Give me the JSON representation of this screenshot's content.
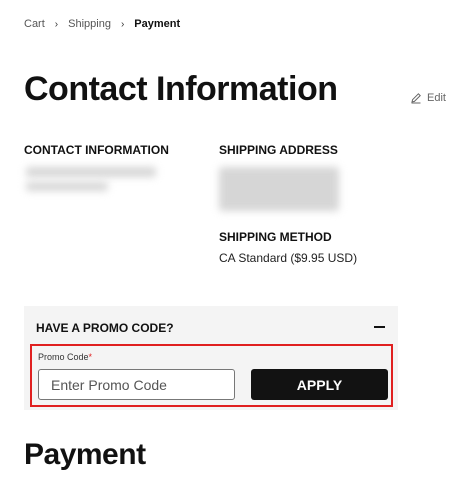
{
  "breadcrumb": {
    "items": [
      {
        "label": "Cart"
      },
      {
        "label": "Shipping"
      },
      {
        "label": "Payment"
      }
    ],
    "separator": "›"
  },
  "page": {
    "title": "Contact Information",
    "edit_label": "Edit"
  },
  "contact": {
    "heading": "CONTACT INFORMATION"
  },
  "shipping_address": {
    "heading": "SHIPPING ADDRESS"
  },
  "shipping_method": {
    "heading": "SHIPPING METHOD",
    "value": "CA Standard ($9.95 USD)"
  },
  "promo": {
    "heading": "HAVE A PROMO CODE?",
    "field_label": "Promo Code",
    "required_marker": "*",
    "placeholder": "Enter Promo Code",
    "apply_label": "APPLY"
  },
  "payment": {
    "title": "Payment"
  },
  "colors": {
    "accent": "#e02020",
    "button_bg": "#121212",
    "panel_bg": "#f4f4f4"
  }
}
